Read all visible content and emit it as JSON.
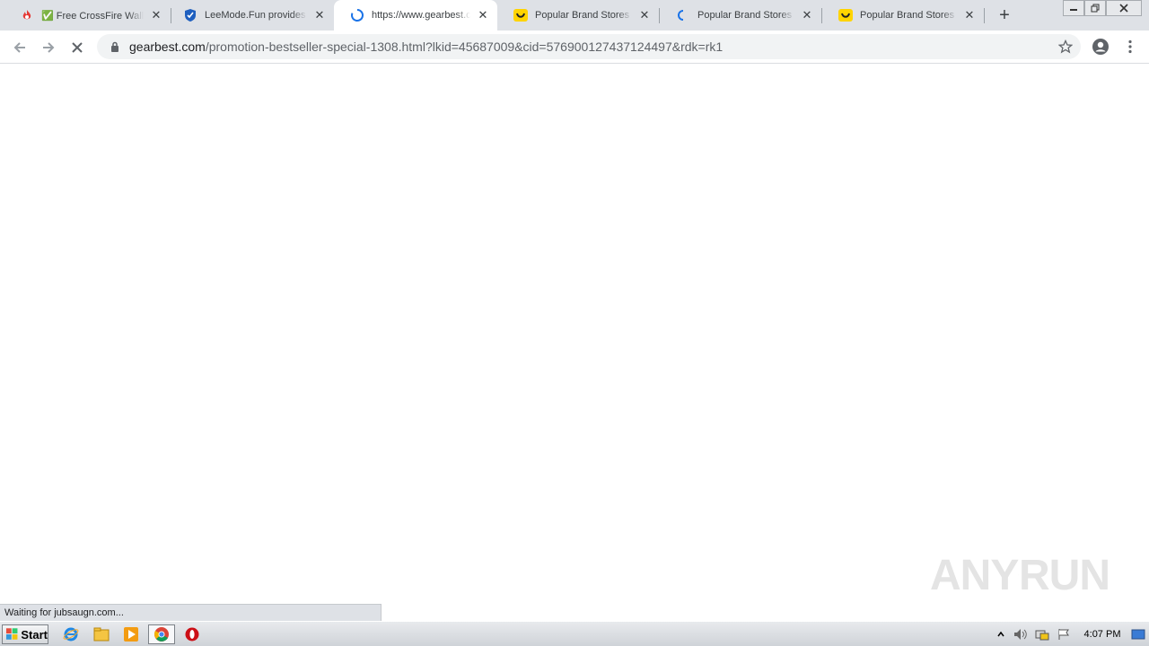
{
  "browser": {
    "tabs": [
      {
        "title": "✅ Free CrossFire WallHack",
        "favicon": "red-fire-icon",
        "loading": false,
        "active": false
      },
      {
        "title": "LeeMode.Fun provides c",
        "favicon": "shield-icon",
        "loading": false,
        "active": false
      },
      {
        "title": "https://www.gearbest.com",
        "favicon": "loading-spinner-icon",
        "loading": true,
        "active": true
      },
      {
        "title": "Popular Brand Stores Sale",
        "favicon": "gearbest-smile-icon",
        "loading": false,
        "active": false
      },
      {
        "title": "Popular Brand Stores Sale",
        "favicon": "loading-spinner-icon",
        "loading": true,
        "active": false
      },
      {
        "title": "Popular Brand Stores Sale",
        "favicon": "gearbest-smile-icon",
        "loading": false,
        "active": false
      }
    ],
    "close_glyph": "✕",
    "new_tab_glyph": "+",
    "url_host": "gearbest.com",
    "url_path": "/promotion-bestseller-special-1308.html?lkid=45687009&cid=576900127437124497&rdk=rk1",
    "status_text": "Waiting for jubsaugn.com...",
    "colors": {
      "tabstrip": "#dee1e6",
      "omnibox": "#f1f3f4",
      "accent": "#1a73e8",
      "gearbest": "#ffd400"
    }
  },
  "watermark": {
    "left": "ANY",
    "right": "RUN"
  },
  "taskbar": {
    "start_label": "Start",
    "apps": [
      "internet-explorer-icon",
      "file-explorer-icon",
      "media-player-icon",
      "chrome-icon",
      "opera-icon"
    ],
    "clock": "4:07 PM"
  }
}
